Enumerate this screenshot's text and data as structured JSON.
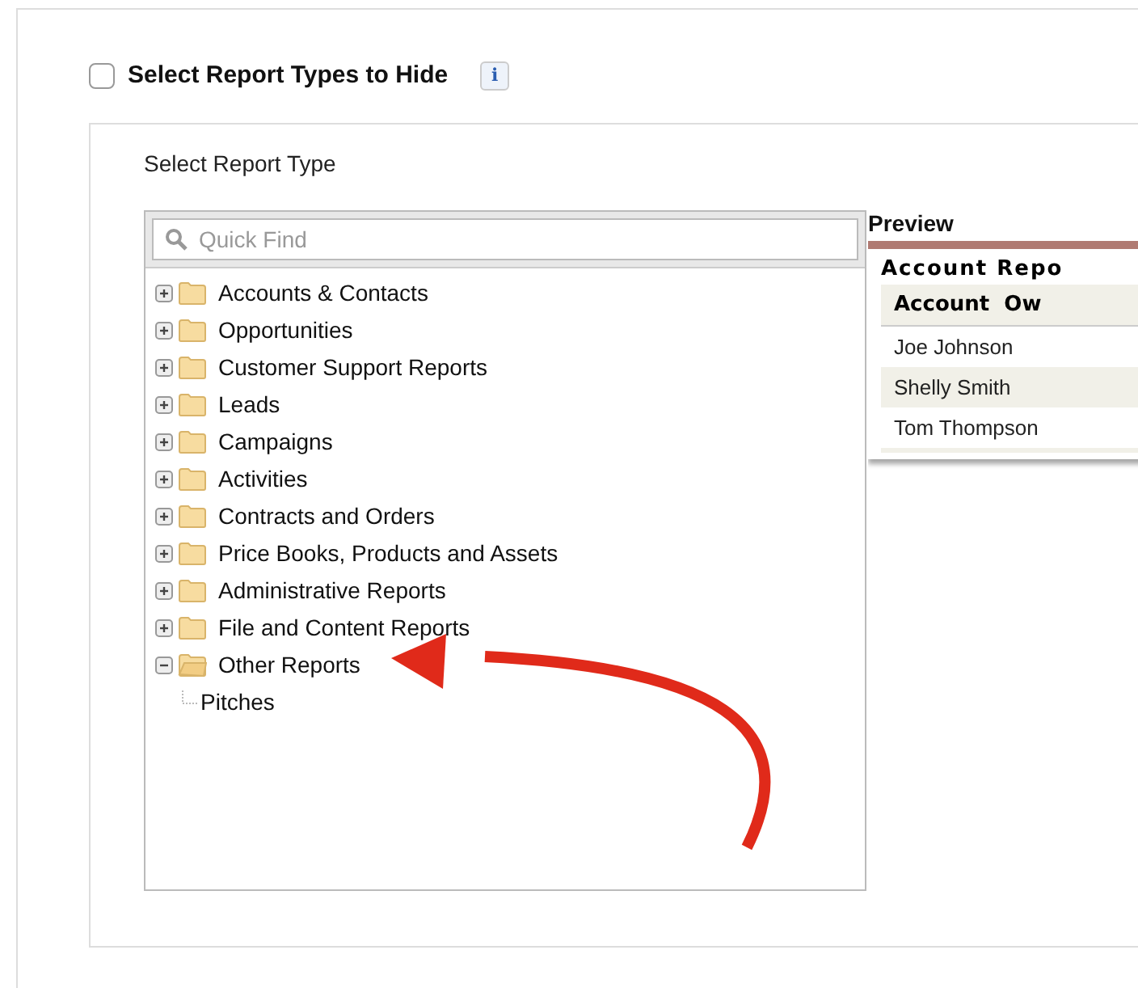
{
  "hide_option": {
    "label": "Select Report Types to Hide",
    "checked": false,
    "info_icon": "i"
  },
  "panel": {
    "title": "Select Report Type",
    "search": {
      "placeholder": "Quick Find"
    },
    "tree": [
      {
        "label": "Accounts & Contacts",
        "expanded": false
      },
      {
        "label": "Opportunities",
        "expanded": false
      },
      {
        "label": "Customer Support Reports",
        "expanded": false
      },
      {
        "label": "Leads",
        "expanded": false
      },
      {
        "label": "Campaigns",
        "expanded": false
      },
      {
        "label": "Activities",
        "expanded": false
      },
      {
        "label": "Contracts and Orders",
        "expanded": false
      },
      {
        "label": "Price Books, Products and Assets",
        "expanded": false
      },
      {
        "label": "Administrative Reports",
        "expanded": false
      },
      {
        "label": "File and Content Reports",
        "expanded": false
      },
      {
        "label": "Other Reports",
        "expanded": true,
        "children": [
          {
            "label": "Pitches"
          }
        ]
      }
    ]
  },
  "preview": {
    "title": "Preview",
    "report_title": "Account Repo",
    "columns": [
      "Account  Ow"
    ],
    "rows": [
      [
        "Joe Johnson"
      ],
      [
        "Shelly Smith"
      ],
      [
        "Tom Thompson"
      ]
    ]
  }
}
